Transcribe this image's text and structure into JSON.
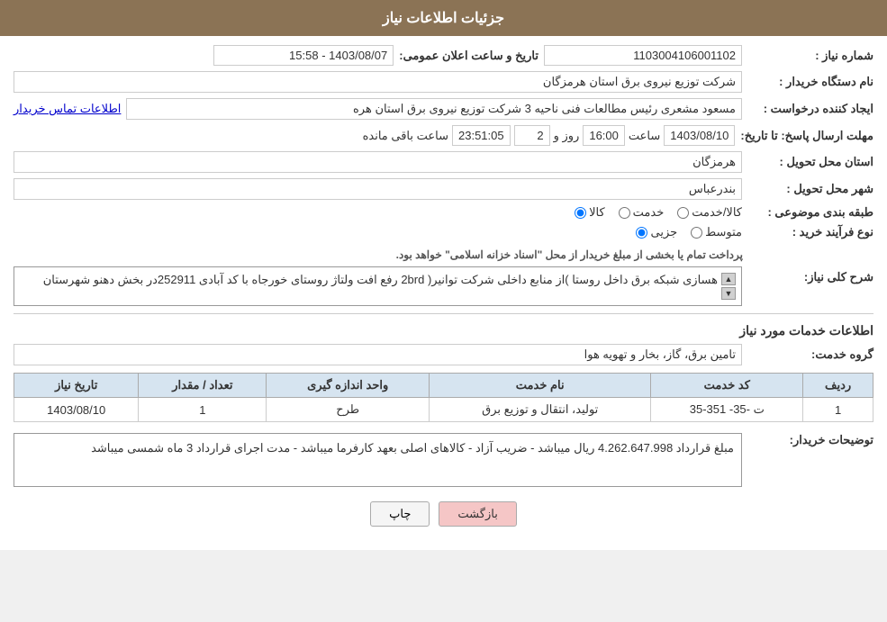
{
  "header": {
    "title": "جزئیات اطلاعات نیاز"
  },
  "fields": {
    "need_number_label": "شماره نیاز :",
    "need_number_value": "1103004106001102",
    "announce_label": "تاریخ و ساعت اعلان عمومی:",
    "announce_value": "1403/08/07 - 15:58",
    "buyer_name_label": "نام دستگاه خریدار :",
    "buyer_name_value": "شرکت توزیع نیروی برق استان هرمزگان",
    "requester_label": "ایجاد کننده درخواست :",
    "requester_value": "مسعود مشعری رئیس مطالعات فنی ناحیه 3 شرکت توزیع نیروی برق استان هره",
    "requester_link": "اطلاعات تماس خریدار",
    "deadline_label": "مهلت ارسال پاسخ: تا تاریخ:",
    "deadline_date": "1403/08/10",
    "deadline_time_label": "ساعت",
    "deadline_time": "16:00",
    "deadline_day_label": "روز و",
    "deadline_day": "2",
    "deadline_remaining_label": "ساعت باقی مانده",
    "deadline_remaining": "23:51:05",
    "province_label": "استان محل تحویل :",
    "province_value": "هرمزگان",
    "city_label": "شهر محل تحویل :",
    "city_value": "بندرعباس",
    "category_label": "طبقه بندی موضوعی :",
    "category_kala": "کالا",
    "category_khadamat": "خدمت",
    "category_kala_khadamat": "کالا/خدمت",
    "purchase_type_label": "نوع فرآیند خرید :",
    "purchase_jozii": "جزیی",
    "purchase_motavasset": "متوسط",
    "purchase_note": "پرداخت تمام یا بخشی از مبلغ خریدار از محل \"اسناد خزانه اسلامی\" خواهد بود.",
    "description_label": "شرح کلی نیاز:",
    "description_value": "هسازی شبکه برق داخل روستا )از منابع داخلی شرکت توانیر( 2brd رفع افت ولتاژ روستای خورجاه با کد آبادی 252911در بخش دهنو شهرستان",
    "services_section_label": "اطلاعات خدمات مورد نیاز",
    "service_group_label": "گروه خدمت:",
    "service_group_value": "تامین برق، گاز، بخار و تهویه هوا",
    "table": {
      "headers": [
        "ردیف",
        "کد خدمت",
        "نام خدمت",
        "واحد اندازه گیری",
        "تعداد / مقدار",
        "تاریخ نیاز"
      ],
      "rows": [
        {
          "row": "1",
          "code": "ت -35- 351-35",
          "name": "تولید، انتقال و توزیع برق",
          "unit": "طرح",
          "count": "1",
          "date": "1403/08/10"
        }
      ]
    },
    "notes_label": "توضیحات خریدار:",
    "notes_value": "مبلغ قرارداد 4.262.647.998 ریال میباشد - ضریب آزاد - کالاهای اصلی بعهد کارفرما میباشد - مدت اجرای قرارداد 3 ماه شمسی میباشد"
  },
  "buttons": {
    "print": "چاپ",
    "back": "بازگشت"
  }
}
